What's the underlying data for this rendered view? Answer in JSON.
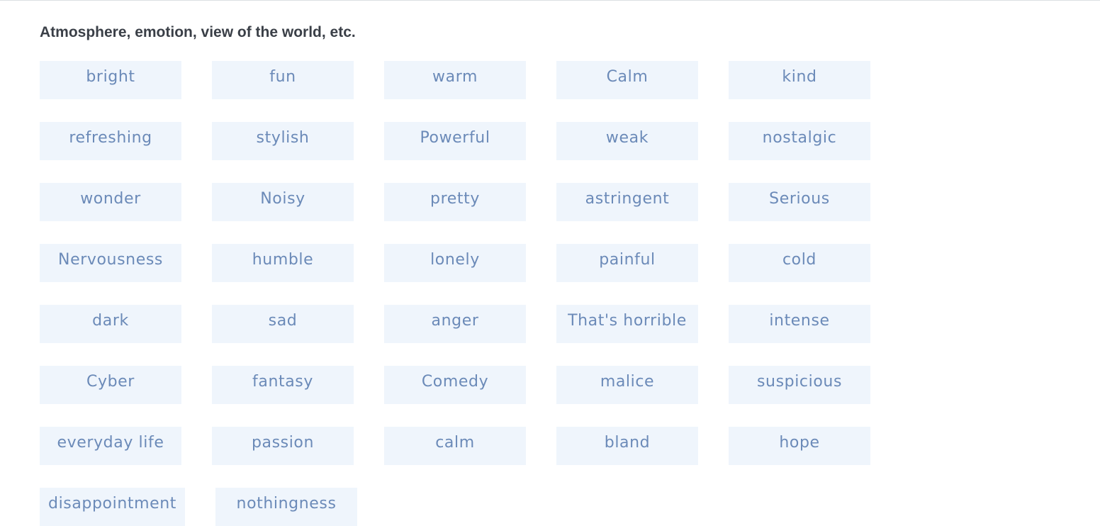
{
  "section": {
    "title": "Atmosphere, emotion, view of the world, etc."
  },
  "tags": [
    "bright",
    "fun",
    "warm",
    "Calm",
    "kind",
    "refreshing",
    "stylish",
    "Powerful",
    "weak",
    "nostalgic",
    "wonder",
    "Noisy",
    "pretty",
    "astringent",
    "Serious",
    "Nervousness",
    "humble",
    "lonely",
    "painful",
    "cold",
    "dark",
    "sad",
    "anger",
    "That's horrible",
    "intense",
    "Cyber",
    "fantasy",
    "Comedy",
    "malice",
    "suspicious",
    "everyday life",
    "passion",
    "calm",
    "bland",
    "hope",
    "disappointment",
    "nothingness"
  ],
  "colors": {
    "tag_background": "#eff5fc",
    "tag_text": "#6b8ab8",
    "title_text": "#3a3f47",
    "top_rule": "#dcdfe3"
  }
}
